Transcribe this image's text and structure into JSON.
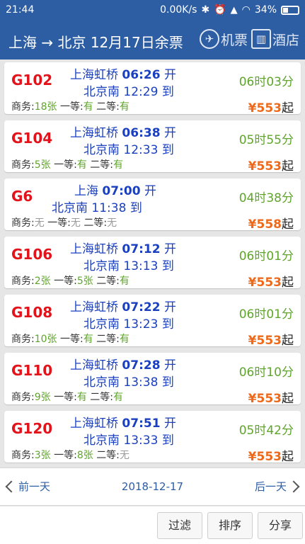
{
  "status": {
    "time": "21:44",
    "speed": "0.00K/s",
    "battery": "34%"
  },
  "header": {
    "title": "上海 → 北京 12月17日余票",
    "flight_label": "机票",
    "hotel_label": "酒店"
  },
  "trains": [
    {
      "no": "G102",
      "from": "上海虹桥",
      "dep": "06:26",
      "dep_suffix": "开",
      "to": "北京南",
      "arr": "12:29",
      "arr_suffix": "到",
      "duration": "06时03分",
      "seats": [
        {
          "cls": "商务:",
          "val": "18张",
          "avail": "g"
        },
        {
          "cls": "一等:",
          "val": "有",
          "avail": "g"
        },
        {
          "cls": "二等:",
          "val": "有",
          "avail": "g"
        }
      ],
      "price": "553",
      "price_suffix": "起"
    },
    {
      "no": "G104",
      "from": "上海虹桥",
      "dep": "06:38",
      "dep_suffix": "开",
      "to": "北京南",
      "arr": "12:33",
      "arr_suffix": "到",
      "duration": "05时55分",
      "seats": [
        {
          "cls": "商务:",
          "val": "5张",
          "avail": "g"
        },
        {
          "cls": "一等:",
          "val": "有",
          "avail": "g"
        },
        {
          "cls": "二等:",
          "val": "有",
          "avail": "g"
        }
      ],
      "price": "553",
      "price_suffix": "起"
    },
    {
      "no": "G6",
      "from": "上海",
      "dep": "07:00",
      "dep_suffix": "开",
      "to": "北京南",
      "arr": "11:38",
      "arr_suffix": "到",
      "duration": "04时38分",
      "seats": [
        {
          "cls": "商务:",
          "val": "无",
          "avail": "n"
        },
        {
          "cls": "一等:",
          "val": "无",
          "avail": "n"
        },
        {
          "cls": "二等:",
          "val": "无",
          "avail": "n"
        }
      ],
      "price": "558",
      "price_suffix": "起"
    },
    {
      "no": "G106",
      "from": "上海虹桥",
      "dep": "07:12",
      "dep_suffix": "开",
      "to": "北京南",
      "arr": "13:13",
      "arr_suffix": "到",
      "duration": "06时01分",
      "seats": [
        {
          "cls": "商务:",
          "val": "2张",
          "avail": "g"
        },
        {
          "cls": "一等:",
          "val": "5张",
          "avail": "g"
        },
        {
          "cls": "二等:",
          "val": "有",
          "avail": "g"
        }
      ],
      "price": "553",
      "price_suffix": "起"
    },
    {
      "no": "G108",
      "from": "上海虹桥",
      "dep": "07:22",
      "dep_suffix": "开",
      "to": "北京南",
      "arr": "13:23",
      "arr_suffix": "到",
      "duration": "06时01分",
      "seats": [
        {
          "cls": "商务:",
          "val": "10张",
          "avail": "g"
        },
        {
          "cls": "一等:",
          "val": "有",
          "avail": "g"
        },
        {
          "cls": "二等:",
          "val": "有",
          "avail": "g"
        }
      ],
      "price": "553",
      "price_suffix": "起"
    },
    {
      "no": "G110",
      "from": "上海虹桥",
      "dep": "07:28",
      "dep_suffix": "开",
      "to": "北京南",
      "arr": "13:38",
      "arr_suffix": "到",
      "duration": "06时10分",
      "seats": [
        {
          "cls": "商务:",
          "val": "9张",
          "avail": "g"
        },
        {
          "cls": "一等:",
          "val": "有",
          "avail": "g"
        },
        {
          "cls": "二等:",
          "val": "有",
          "avail": "g"
        }
      ],
      "price": "553",
      "price_suffix": "起"
    },
    {
      "no": "G120",
      "from": "上海虹桥",
      "dep": "07:51",
      "dep_suffix": "开",
      "to": "北京南",
      "arr": "13:33",
      "arr_suffix": "到",
      "duration": "05时42分",
      "seats": [
        {
          "cls": "商务:",
          "val": "3张",
          "avail": "g"
        },
        {
          "cls": "一等:",
          "val": "8张",
          "avail": "g"
        },
        {
          "cls": "二等:",
          "val": "无",
          "avail": "n"
        }
      ],
      "price": "553",
      "price_suffix": "起"
    }
  ],
  "currency": "¥",
  "datebar": {
    "prev": "前一天",
    "date": "2018-12-17",
    "next": "后一天"
  },
  "footer": {
    "filter": "过滤",
    "sort": "排序",
    "share": "分享"
  },
  "colors": {
    "primary": "#2d5da3",
    "train": "#e3131b",
    "available": "#5fa52b",
    "price": "#ee6a1a",
    "unavailable": "#9a9a9a"
  }
}
